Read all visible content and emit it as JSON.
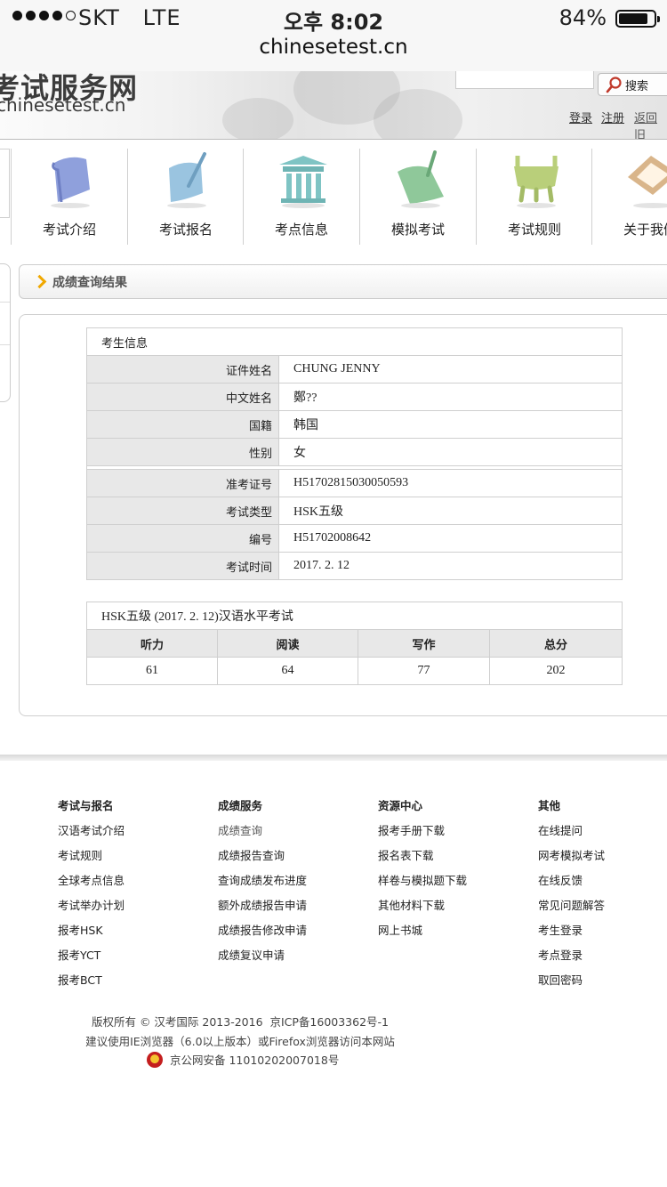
{
  "status_bar": {
    "carrier": "SKT   LTE",
    "time": "오후 8:02",
    "battery": "84%",
    "battery_level": 0.84,
    "signal_bars": 4
  },
  "address_bar": {
    "url": "chinesetest.cn"
  },
  "site": {
    "name": "考试服务网",
    "domain": "chinesetest.cn",
    "search_button": "搜索",
    "login": "登录",
    "register": "注册",
    "return_old": "返回旧"
  },
  "nav": {
    "items": [
      {
        "label": "考试介绍",
        "icon": "scroll-icon",
        "color": "#8fa0dc"
      },
      {
        "label": "考试报名",
        "icon": "register-icon",
        "color": "#9ac4e0"
      },
      {
        "label": "考点信息",
        "icon": "building-icon",
        "color": "#7fc4c4"
      },
      {
        "label": "模拟考试",
        "icon": "paper-icon",
        "color": "#8fc89a"
      },
      {
        "label": "考试规则",
        "icon": "cauldron-icon",
        "color": "#b9cf7a"
      },
      {
        "label": "关于我们",
        "icon": "frame-icon",
        "color": "#d9b58a"
      }
    ]
  },
  "result": {
    "header": "成绩查询结果",
    "candidate_section": "考生信息",
    "rows": [
      {
        "label": "证件姓名",
        "value": "CHUNG JENNY"
      },
      {
        "label": "中文姓名",
        "value": "鄭??"
      },
      {
        "label": "国籍",
        "value": "韩国"
      },
      {
        "label": "性别",
        "value": "女"
      }
    ],
    "exam_rows": [
      {
        "label": "准考证号",
        "value": "H51702815030050593"
      },
      {
        "label": "考试类型",
        "value": "HSK五级"
      },
      {
        "label": "编号",
        "value": "H51702008642"
      },
      {
        "label": "考试时间",
        "value": "2017. 2. 12"
      }
    ],
    "score_caption": "HSK五级 (2017. 2. 12)汉语水平考试",
    "score_columns": [
      "听力",
      "阅读",
      "写作",
      "总分"
    ],
    "scores": [
      "61",
      "64",
      "77",
      "202"
    ]
  },
  "footer": {
    "columns": [
      {
        "title": "考试与报名",
        "links": [
          "汉语考试介绍",
          "考试规则",
          "全球考点信息",
          "考试举办计划",
          "报考HSK",
          "报考YCT",
          "报考BCT"
        ]
      },
      {
        "title": "成绩服务",
        "links": [
          "成绩查询",
          "成绩报告查询",
          "查询成绩发布进度",
          "额外成绩报告申请",
          "成绩报告修改申请",
          "成绩复议申请"
        ]
      },
      {
        "title": "资源中心",
        "links": [
          "报考手册下载",
          "报名表下载",
          "样卷与模拟题下载",
          "其他材料下载",
          "网上书城"
        ]
      },
      {
        "title": "其他",
        "links": [
          "在线提问",
          "网考模拟考试",
          "在线反馈",
          "常见问题解答",
          "考生登录",
          "考点登录",
          "取回密码"
        ]
      }
    ],
    "copyright": "版权所有 © 汉考国际 2013-2016  京ICP备16003362号-1",
    "browser_note": "建议使用IE浏览器（6.0以上版本）或Firefox浏览器访问本网站",
    "police_record": "京公网安备 11010202007018号"
  }
}
